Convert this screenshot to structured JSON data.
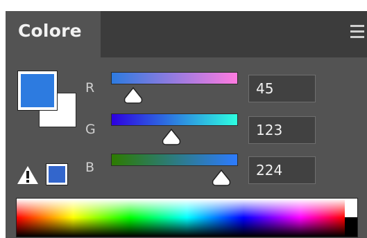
{
  "panel": {
    "tab_label": "Colore",
    "menu_icon": "panel-menu-icon"
  },
  "color": {
    "foreground": "#2d7be0",
    "background": "#ffffff",
    "web_safe": "#3366cc"
  },
  "channels": [
    {
      "letter": "R",
      "value": "45",
      "gradient_start": "#2d7be0",
      "gradient_end": "#ff7be0"
    },
    {
      "letter": "G",
      "value": "123",
      "gradient_start": "#2d00e0",
      "gradient_end": "#2dffe0"
    },
    {
      "letter": "B",
      "value": "224",
      "gradient_start": "#2d7b00",
      "gradient_end": "#2d7bff"
    }
  ],
  "icons": {
    "warning": "warning-icon",
    "web_safe": "web-safe-swatch"
  },
  "spectrum": {
    "label": "color-ramp"
  }
}
